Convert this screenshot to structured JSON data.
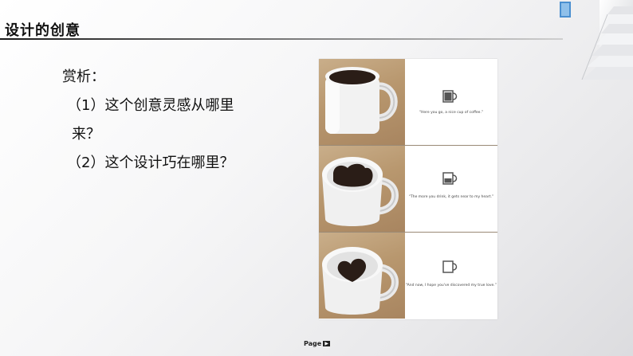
{
  "slide": {
    "title": "设计的创意",
    "body_lines": [
      "赏析：",
      "（1）这个创意灵感从哪里",
      "来？",
      "（2）这个设计巧在哪里？"
    ]
  },
  "figure": {
    "panels": [
      {
        "caption": "“Here you go, a nice cup of coffee.”",
        "coffee_level": "full"
      },
      {
        "caption": "“The more you drink, it gets near to my heart.”",
        "coffee_level": "half"
      },
      {
        "caption": "“And now, I hope you've discovered my true love.”",
        "coffee_level": "heart"
      }
    ]
  },
  "footer": {
    "page_label": "Page"
  },
  "colors": {
    "title_rule": "#1a1a1a",
    "wood": "#b8976e",
    "coffee": "#2a1d17"
  }
}
